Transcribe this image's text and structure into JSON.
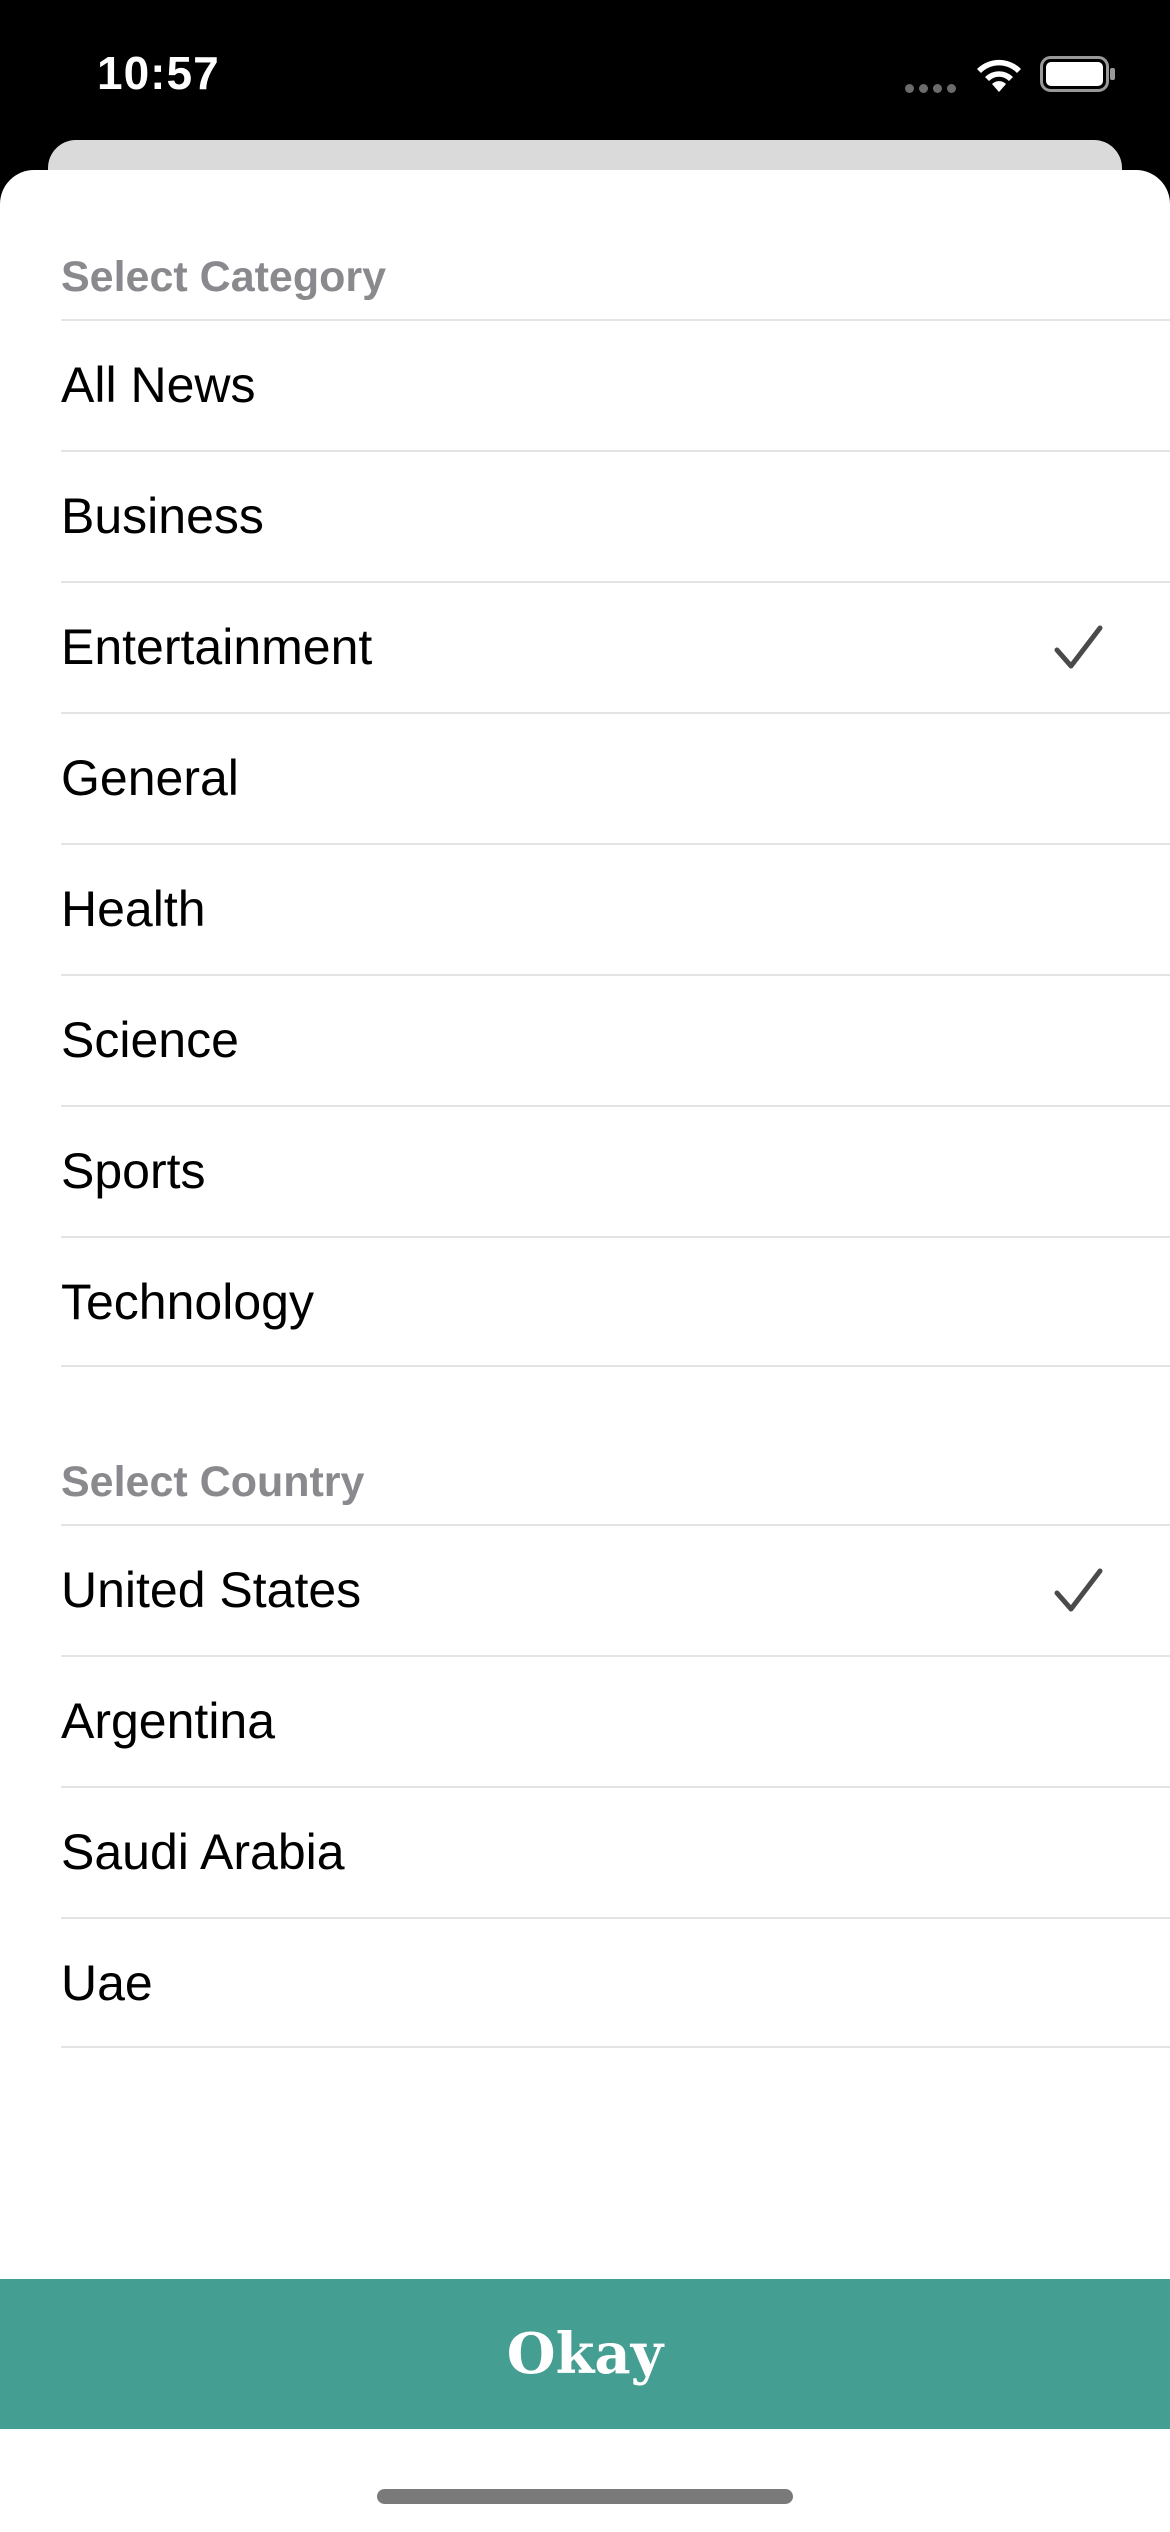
{
  "status_bar": {
    "time": "10:57",
    "wifi_icon": "wifi-icon",
    "battery_icon": "battery-icon"
  },
  "category_section": {
    "header": "Select Category",
    "items": [
      {
        "label": "All News",
        "selected": false
      },
      {
        "label": "Business",
        "selected": false
      },
      {
        "label": "Entertainment",
        "selected": true
      },
      {
        "label": "General",
        "selected": false
      },
      {
        "label": "Health",
        "selected": false
      },
      {
        "label": "Science",
        "selected": false
      },
      {
        "label": "Sports",
        "selected": false
      },
      {
        "label": "Technology",
        "selected": false
      }
    ]
  },
  "country_section": {
    "header": "Select Country",
    "items": [
      {
        "label": "United States",
        "selected": true
      },
      {
        "label": "Argentina",
        "selected": false
      },
      {
        "label": "Saudi Arabia",
        "selected": false
      },
      {
        "label": "Uae",
        "selected": false
      }
    ]
  },
  "okay_button": {
    "label": "Okay"
  },
  "colors": {
    "accent": "#459e92",
    "header_text": "#8a8a8e",
    "checkmark": "#4a4a4a"
  }
}
